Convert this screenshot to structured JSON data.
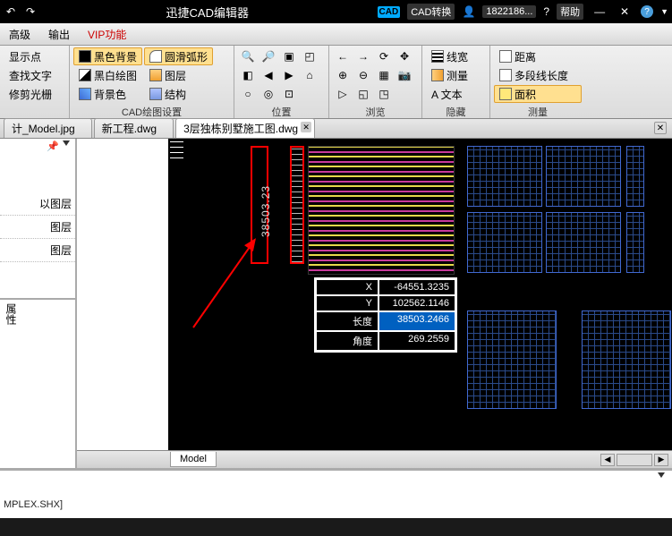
{
  "title": "迅捷CAD编辑器",
  "title_right": {
    "convert": "CAD转换",
    "phone": "1822186...",
    "help": "帮助"
  },
  "menu": [
    "高级",
    "输出",
    "VIP功能"
  ],
  "ribbon": {
    "col1": [
      "显示点",
      "查找文字",
      "修剪光栅"
    ],
    "col2": {
      "black_bg": "黑色背景",
      "bw_draw": "黑白绘图",
      "bg_color": "背景色",
      "label": "CAD绘图设置"
    },
    "col3": {
      "arc": "圆滑弧形",
      "layer": "图层",
      "struct": "结构"
    },
    "pos_label": "位置",
    "view_label": "浏览",
    "hide": {
      "linew": "线宽",
      "meas": "测量",
      "text": "A 文本",
      "label": "隐藏"
    },
    "measure": {
      "dist": "距离",
      "multi": "多段线长度",
      "area": "面积",
      "label": "测量"
    }
  },
  "tabs": [
    "计_Model.jpg",
    "新工程.dwg",
    "3层独栋别墅施工图.dwg"
  ],
  "side": {
    "items": [
      "以图层",
      "图层",
      "图层"
    ],
    "panel2": "属性"
  },
  "coord": {
    "x": {
      "k": "X",
      "v": "-64551.3235"
    },
    "y": {
      "k": "Y",
      "v": "102562.1146"
    },
    "len": {
      "k": "长度",
      "v": "38503.2466"
    },
    "ang": {
      "k": "角度",
      "v": "269.2559"
    }
  },
  "dim_value": "38503.23",
  "model_tab": "Model",
  "console": "MPLEX.SHX]"
}
